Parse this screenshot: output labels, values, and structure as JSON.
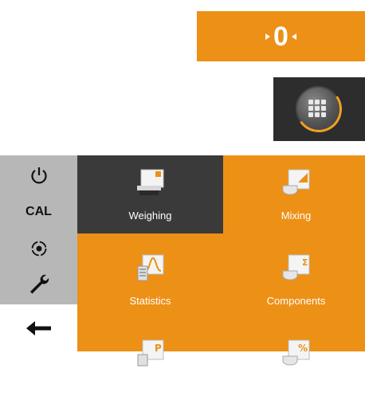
{
  "zero_button": {
    "label": "0",
    "color": "#ec9016"
  },
  "apps_button": {
    "icon": "grid-icon",
    "ring_color": "#f0a020"
  },
  "sidebar": {
    "items": [
      {
        "icon": "power-icon"
      },
      {
        "label": "CAL"
      },
      {
        "icon": "level-target-icon"
      },
      {
        "icon": "wrench-icon"
      }
    ],
    "back_icon": "back-arrow-icon"
  },
  "apps": {
    "tiles": [
      {
        "label": "Weighing",
        "icon": "weighing-app-icon",
        "active": true
      },
      {
        "label": "Mixing",
        "icon": "mixing-app-icon",
        "active": false
      },
      {
        "label": "Statistics",
        "icon": "statistics-app-icon",
        "active": false
      },
      {
        "label": "Components",
        "icon": "components-app-icon",
        "active": false
      },
      {
        "label": "",
        "icon": "piece-counting-app-icon",
        "active": false
      },
      {
        "label": "",
        "icon": "percent-weighing-app-icon",
        "active": false
      }
    ]
  },
  "colors": {
    "accent": "#ec9016",
    "selected_tile": "#3a3a3a",
    "sidebar_bg": "#b7b7b7"
  }
}
